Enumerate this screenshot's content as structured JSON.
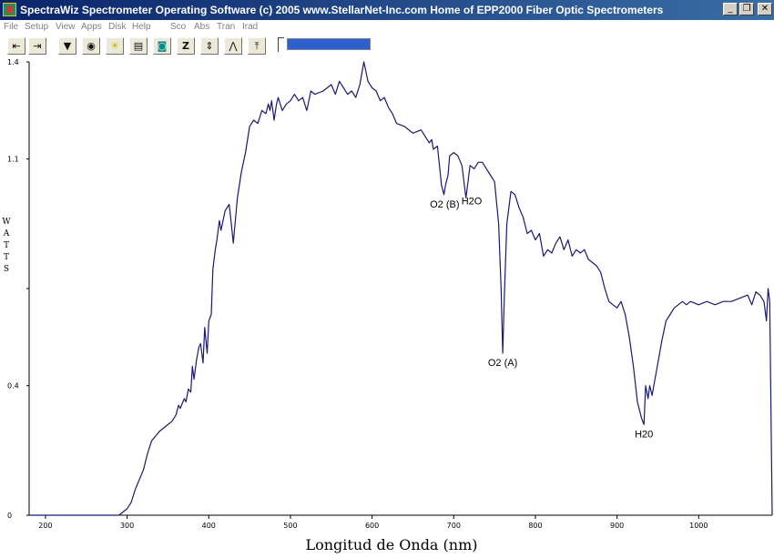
{
  "window": {
    "title": "SpectraWiz  Spectrometer Operating Software (c) 2005  www.StellarNet-Inc.com  Home of EPP2000 Fiber Optic Spectrometers",
    "minimize_glyph": "_",
    "maximize_glyph": "❐",
    "close_glyph": "✕"
  },
  "menu": [
    "File",
    "Setup",
    "View",
    "Apps",
    "Disk",
    "Help",
    "Sco",
    "Abs",
    "Tran",
    "Irad"
  ],
  "toolbar": {
    "buttons": [
      {
        "name": "scroll-left-icon",
        "glyph": "⇤"
      },
      {
        "name": "scroll-right-icon",
        "glyph": "⇥"
      },
      {
        "name": "save-spectrum-icon",
        "glyph": "▼"
      },
      {
        "name": "dark-reference-icon",
        "glyph": "◉"
      },
      {
        "name": "light-reference-icon",
        "glyph": "☀"
      },
      {
        "name": "print-icon",
        "glyph": "▤"
      },
      {
        "name": "capture-icon",
        "glyph": "◙"
      },
      {
        "name": "zoom-icon",
        "glyph": "Z"
      },
      {
        "name": "scale-y-icon",
        "glyph": "⇕"
      },
      {
        "name": "peak-icon",
        "glyph": "⋀"
      },
      {
        "name": "autoscale-icon",
        "glyph": "⤒"
      }
    ],
    "progress_fraction": 1.0
  },
  "chart_data": {
    "type": "line",
    "title": "",
    "xlabel": "Longitud de Onda (nm)",
    "ylabel": "WATTS",
    "xlim": [
      180,
      1090
    ],
    "ylim": [
      0,
      1.4
    ],
    "x_ticks": [
      200,
      300,
      400,
      500,
      600,
      700,
      800,
      900,
      1000
    ],
    "y_tick_labels": [
      {
        "value": 0,
        "label": "0"
      },
      {
        "value": 0.4,
        "label": "0.4"
      },
      {
        "value": 0.7,
        "label": ""
      },
      {
        "value": 1.1,
        "label": "1.1"
      },
      {
        "value": 1.4,
        "label": "1.4"
      }
    ],
    "grid": false,
    "line_color": "#1a1a6e",
    "series": [
      {
        "x": [
          180,
          290,
          300,
          305,
          310,
          320,
          325,
          330,
          340,
          345,
          350,
          355,
          360,
          363,
          365,
          370,
          372,
          375,
          378,
          380,
          382,
          385,
          388,
          390,
          393,
          395,
          398,
          400,
          403,
          405,
          408,
          410,
          413,
          415,
          420,
          425,
          428,
          430,
          435,
          440,
          445,
          450,
          455,
          460,
          465,
          470,
          473,
          475,
          477,
          480,
          483,
          485,
          490,
          495,
          500,
          505,
          510,
          515,
          520,
          525,
          530,
          540,
          545,
          550,
          555,
          560,
          565,
          570,
          575,
          580,
          585,
          590,
          595,
          600,
          605,
          610,
          615,
          620,
          625,
          630,
          640,
          650,
          660,
          670,
          673,
          675,
          680,
          685,
          688,
          690,
          693,
          695,
          700,
          705,
          710,
          715,
          718,
          720,
          725,
          730,
          735,
          740,
          745,
          750,
          755,
          758,
          760,
          762,
          765,
          768,
          770,
          775,
          780,
          785,
          790,
          795,
          800,
          805,
          810,
          815,
          820,
          825,
          830,
          835,
          840,
          845,
          850,
          855,
          860,
          865,
          870,
          875,
          880,
          885,
          890,
          895,
          900,
          905,
          910,
          915,
          920,
          925,
          930,
          933,
          935,
          938,
          940,
          943,
          945,
          950,
          955,
          960,
          965,
          970,
          975,
          980,
          985,
          990,
          1000,
          1010,
          1020,
          1030,
          1040,
          1050,
          1060,
          1065,
          1070,
          1075,
          1080,
          1083,
          1085,
          1087,
          1090
        ],
        "y": [
          0,
          0,
          0.02,
          0.04,
          0.08,
          0.14,
          0.19,
          0.23,
          0.26,
          0.27,
          0.28,
          0.29,
          0.31,
          0.34,
          0.33,
          0.36,
          0.35,
          0.39,
          0.38,
          0.46,
          0.42,
          0.48,
          0.52,
          0.53,
          0.47,
          0.58,
          0.5,
          0.6,
          0.62,
          0.76,
          0.82,
          0.85,
          0.91,
          0.88,
          0.94,
          0.96,
          0.89,
          0.84,
          0.98,
          1.06,
          1.12,
          1.2,
          1.22,
          1.21,
          1.25,
          1.24,
          1.27,
          1.25,
          1.28,
          1.22,
          1.27,
          1.29,
          1.25,
          1.27,
          1.28,
          1.3,
          1.28,
          1.29,
          1.25,
          1.31,
          1.3,
          1.31,
          1.32,
          1.33,
          1.3,
          1.34,
          1.32,
          1.3,
          1.31,
          1.29,
          1.33,
          1.4,
          1.34,
          1.32,
          1.31,
          1.28,
          1.29,
          1.26,
          1.24,
          1.21,
          1.2,
          1.18,
          1.19,
          1.15,
          1.16,
          1.13,
          1.14,
          1.02,
          0.99,
          1.02,
          1.05,
          1.11,
          1.12,
          1.11,
          1.08,
          0.98,
          1.04,
          1.08,
          1.07,
          1.09,
          1.09,
          1.07,
          1.05,
          1.03,
          0.9,
          0.7,
          0.5,
          0.68,
          0.9,
          0.96,
          1.0,
          0.99,
          0.95,
          0.92,
          0.87,
          0.88,
          0.85,
          0.87,
          0.8,
          0.82,
          0.81,
          0.84,
          0.86,
          0.82,
          0.85,
          0.8,
          0.82,
          0.81,
          0.82,
          0.79,
          0.78,
          0.77,
          0.75,
          0.7,
          0.66,
          0.65,
          0.64,
          0.66,
          0.62,
          0.55,
          0.46,
          0.35,
          0.3,
          0.28,
          0.4,
          0.36,
          0.4,
          0.37,
          0.4,
          0.47,
          0.54,
          0.6,
          0.62,
          0.64,
          0.65,
          0.66,
          0.65,
          0.66,
          0.65,
          0.66,
          0.65,
          0.66,
          0.66,
          0.67,
          0.68,
          0.65,
          0.69,
          0.68,
          0.66,
          0.6,
          0.7,
          0.66,
          0.0
        ]
      }
    ],
    "annotations": [
      {
        "text": "O2 (B)",
        "x": 688,
        "y": 0.99,
        "anchor": "end-below"
      },
      {
        "text": "H2O",
        "x": 722,
        "y": 1.0,
        "anchor": "below"
      },
      {
        "text": "O2 (A)",
        "x": 760,
        "y": 0.5,
        "anchor": "below"
      },
      {
        "text": "H20",
        "x": 933,
        "y": 0.28,
        "anchor": "below"
      }
    ]
  }
}
